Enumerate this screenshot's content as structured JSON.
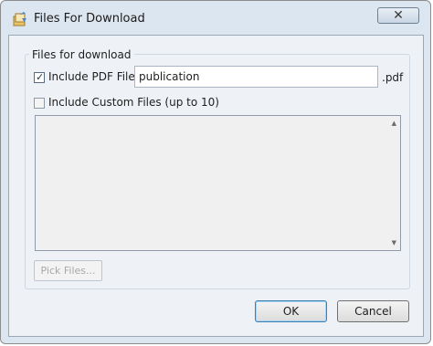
{
  "window": {
    "title": "Files For Download",
    "close_label": "✕"
  },
  "group": {
    "label": "Files for download"
  },
  "pdf": {
    "checkbox_label": "Include PDF File",
    "checked": true,
    "filename_value": "publication",
    "extension": ".pdf"
  },
  "custom": {
    "checkbox_label": "Include Custom Files (up to 10)",
    "checked": false,
    "files": []
  },
  "buttons": {
    "pick_files": "Pick Files...",
    "ok": "OK",
    "cancel": "Cancel"
  },
  "icons": {
    "app": "files-download-icon",
    "scroll_up": "scroll-up-arrow-icon",
    "scroll_down": "scroll-down-arrow-icon"
  }
}
